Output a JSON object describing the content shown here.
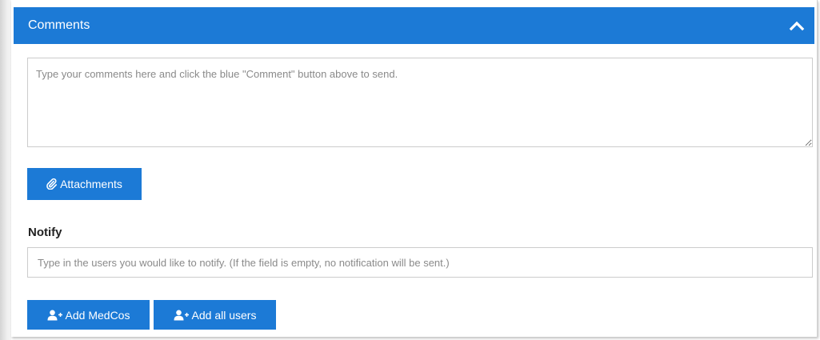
{
  "panel": {
    "title": "Comments",
    "collapse_icon": "chevron-up-icon"
  },
  "comment": {
    "value": "",
    "placeholder": "Type your comments here and click the blue \"Comment\" button above to send."
  },
  "attachments": {
    "label": "Attachments",
    "icon": "paperclip-icon"
  },
  "notify": {
    "label": "Notify",
    "value": "",
    "placeholder": "Type in the users you would like to notify. (If the field is empty, no notification will be sent.)"
  },
  "buttons": {
    "add_medcos": {
      "label": "Add MedCos",
      "icon": "add-user-icon"
    },
    "add_all_users": {
      "label": "Add all users",
      "icon": "add-user-icon"
    }
  },
  "colors": {
    "accent": "#1c7ad6",
    "text_on_accent": "#ffffff",
    "placeholder": "#8a8a8a",
    "border": "#cccccc"
  }
}
